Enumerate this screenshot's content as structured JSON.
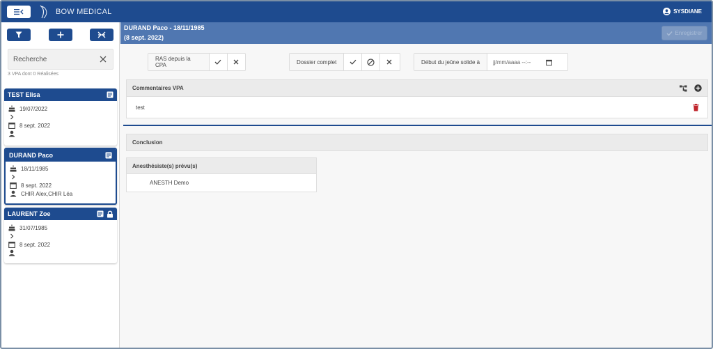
{
  "app": {
    "brand": "BOW MEDICAL",
    "user": "SYSDIANE"
  },
  "sidebar": {
    "search_placeholder": "Recherche",
    "count_text": "3 VPA dont 0 Réalisées",
    "patients": [
      {
        "name": "TEST Elisa",
        "birth": "19/07/2022",
        "date": "8 sept. 2022",
        "surgeon": "",
        "locked": false,
        "selected": false
      },
      {
        "name": "DURAND Paco",
        "birth": "18/11/1985",
        "date": "8 sept. 2022",
        "surgeon": "CHIR Alex,CHIR Léa",
        "locked": false,
        "selected": true
      },
      {
        "name": "LAURENT Zoe",
        "birth": "31/07/1985",
        "date": "8 sept. 2022",
        "surgeon": "",
        "locked": true,
        "selected": false
      }
    ]
  },
  "header": {
    "line1": "DURAND Paco - 18/11/1985",
    "line2": "(8 sept. 2022)",
    "save_label": "Enregistrer"
  },
  "toolbar": {
    "ras_label": "RAS depuis la CPA",
    "dossier_label": "Dossier complet",
    "jeune_label": "Début du jeûne solide à",
    "jeune_placeholder": "jj/mm/aaaa --:--"
  },
  "comments": {
    "title": "Commentaires VPA",
    "items": [
      "test"
    ]
  },
  "conclusion": {
    "title": "Conclusion"
  },
  "anesth": {
    "title": "Anesthésiste(s) prévu(s)",
    "items": [
      "ANESTH Demo"
    ]
  },
  "colors": {
    "primary": "#1e4b8f",
    "header_bar": "#5077b1",
    "delete": "#c0262d"
  }
}
